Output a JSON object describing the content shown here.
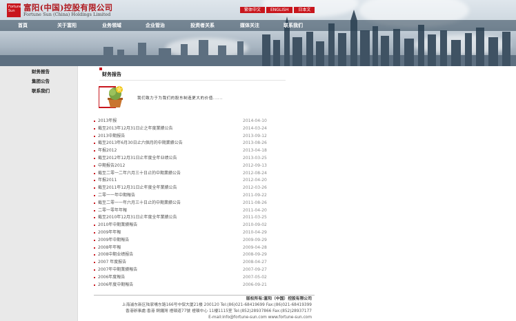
{
  "header": {
    "logo_badge": "Fortune Sun",
    "company_cn": "富阳(中国)控股有限公司",
    "company_en": "Fortune Sun (China) Holdings Limited",
    "languages": [
      "繁体中文",
      "ENGLISH",
      "日本文"
    ],
    "nav": [
      "首頁",
      "关于富阳",
      "业务领域",
      "企业管治",
      "投资者关系",
      "媒体关注",
      "联系我们"
    ]
  },
  "sidebar": {
    "items": [
      "财务报告",
      "集团公告",
      "联系我们"
    ]
  },
  "main": {
    "title": "财务报告",
    "tagline": "我们致力于为我们的股东制造更大的价值......",
    "reports": [
      {
        "title": "2013年报",
        "date": "2014-04-10"
      },
      {
        "title": "截至2013年12月31日止之年度業績公告",
        "date": "2014-03-24"
      },
      {
        "title": "2013中期报告",
        "date": "2013-09-12"
      },
      {
        "title": "截至2013年6月30日止六個月的中期業績公告",
        "date": "2013-08-26"
      },
      {
        "title": "年报2012",
        "date": "2013-04-18"
      },
      {
        "title": "截至2012年12月31日止年度全年业绩公告",
        "date": "2013-03-25"
      },
      {
        "title": "中期报告2012",
        "date": "2012-09-13"
      },
      {
        "title": "截至二零一二年六月三十日止的中期業績公告",
        "date": "2012-08-24"
      },
      {
        "title": "年报2011",
        "date": "2012-04-20"
      },
      {
        "title": "截至2011年12月31日止年度全年業績公告",
        "date": "2012-03-26"
      },
      {
        "title": "二零一一年中期報告",
        "date": "2011-09-22"
      },
      {
        "title": "截至二零一一年六月三十日止的中期業績公告",
        "date": "2011-08-26"
      },
      {
        "title": "二零一零年年報",
        "date": "2011-04-20"
      },
      {
        "title": "截至2010年12月31日止年度全年業績公告",
        "date": "2011-03-25"
      },
      {
        "title": "2010年中期業績報告",
        "date": "2010-09-02"
      },
      {
        "title": "2009年年報",
        "date": "2010-04-29"
      },
      {
        "title": "2009年中期報告",
        "date": "2009-09-29"
      },
      {
        "title": "2008年年報",
        "date": "2009-04-28"
      },
      {
        "title": "2008中期业绩报告",
        "date": "2008-09-29"
      },
      {
        "title": "2007 年度报告",
        "date": "2008-04-27"
      },
      {
        "title": "2007年中期業績報告",
        "date": "2007-09-27"
      },
      {
        "title": "2006年度報告",
        "date": "2007-05-02"
      },
      {
        "title": "2006年度中期報告",
        "date": "2006-09-21"
      }
    ]
  },
  "footer": {
    "copyright": "版权所有:富阳（中国）控股有限公司",
    "address_sh": "上海浦东新区陆家嘴东路166号中保大厦21楼 200120 Tel:(86)021-68419699 Fax:(86)021-68419399",
    "address_hk": "香港辦事處:香港 銅鑼灣 禮頓道77號 禮頓中心 11樓1115室 Tel:(852)28937866 Fax:(852)28937177",
    "email": "E-mail:info@fortune-sun.com www.fortune-sun.com"
  },
  "colors": {
    "accent": "#c8161d",
    "sidebar_bg": "#e9e9e9"
  }
}
